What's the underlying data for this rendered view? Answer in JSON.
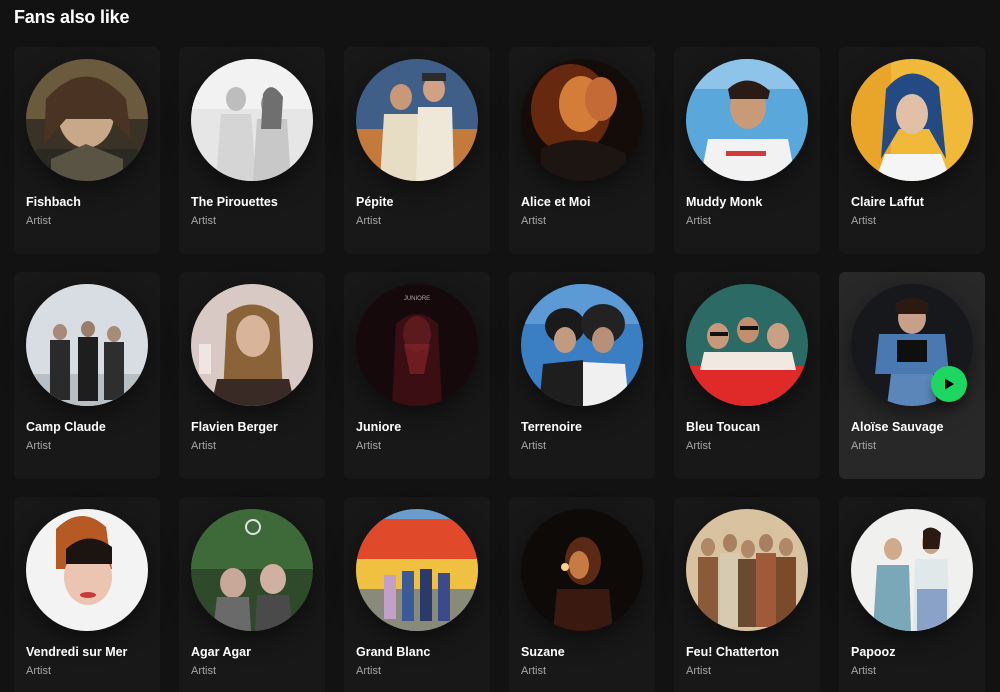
{
  "section": {
    "title": "Fans also like"
  },
  "cards": [
    {
      "name": "Fishbach",
      "sub": "Artist"
    },
    {
      "name": "The Pirouettes",
      "sub": "Artist"
    },
    {
      "name": "Pépite",
      "sub": "Artist"
    },
    {
      "name": "Alice et Moi",
      "sub": "Artist"
    },
    {
      "name": "Muddy Monk",
      "sub": "Artist"
    },
    {
      "name": "Claire Laffut",
      "sub": "Artist"
    },
    {
      "name": "Camp Claude",
      "sub": "Artist"
    },
    {
      "name": "Flavien Berger",
      "sub": "Artist"
    },
    {
      "name": "Juniore",
      "sub": "Artist",
      "cover_text": "JUNIORE"
    },
    {
      "name": "Terrenoire",
      "sub": "Artist"
    },
    {
      "name": "Bleu Toucan",
      "sub": "Artist"
    },
    {
      "name": "Aloïse Sauvage",
      "sub": "Artist",
      "hovered": true,
      "play_icon": "play-icon"
    },
    {
      "name": "Vendredi sur Mer",
      "sub": "Artist"
    },
    {
      "name": "Agar Agar",
      "sub": "Artist"
    },
    {
      "name": "Grand Blanc",
      "sub": "Artist"
    },
    {
      "name": "Suzane",
      "sub": "Artist"
    },
    {
      "name": "Feu! Chatterton",
      "sub": "Artist"
    },
    {
      "name": "Papooz",
      "sub": "Artist"
    }
  ],
  "colors": {
    "background": "#121212",
    "card": "#181818",
    "card_hover": "#282828",
    "accent_play": "#1ed760",
    "subtext": "#a7a7a7"
  }
}
